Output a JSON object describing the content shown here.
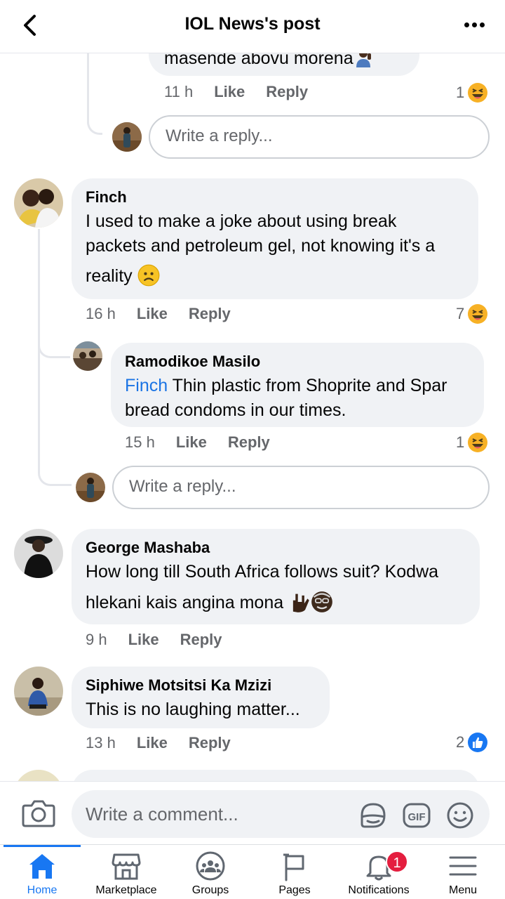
{
  "header": {
    "title": "IOL News's post"
  },
  "comments": {
    "prev_reply": {
      "text_tail": "masende abovu morena",
      "time": "11 h",
      "like": "Like",
      "reply": "Reply",
      "reaction_count": "1",
      "reaction_icon": "haha-icon"
    },
    "reply_box_1": {
      "placeholder": "Write a reply..."
    },
    "finch": {
      "author": "Finch",
      "text_1": "I used to make a joke about using break",
      "text_2": "packets and petroleum gel, not knowing it's a",
      "text_3": "reality",
      "time": "16 h",
      "like": "Like",
      "reply": "Reply",
      "reaction_count": "7",
      "reaction_icon": "haha-icon"
    },
    "ramodikoe": {
      "author": "Ramodikoe Masilo",
      "mention": "Finch",
      "text_1": " Thin plastic from Shoprite and Spar",
      "text_2": "bread condoms in our times.",
      "time": "15 h",
      "like": "Like",
      "reply": "Reply",
      "reaction_count": "1",
      "reaction_icon": "haha-icon"
    },
    "reply_box_2": {
      "placeholder": "Write a reply..."
    },
    "george": {
      "author": "George Mashaba",
      "text_1": "How long till South Africa follows suit? Kodwa",
      "text_2": "hlekani kais angina mona",
      "time": "9 h",
      "like": "Like",
      "reply": "Reply"
    },
    "siphiwe": {
      "author": "Siphiwe Motsitsi Ka Mzizi",
      "text_1": "This is no laughing matter...",
      "time": "13 h",
      "like": "Like",
      "reply": "Reply",
      "reaction_count": "2",
      "reaction_icon": "like-icon"
    }
  },
  "composer": {
    "placeholder": "Write a comment..."
  },
  "tabs": [
    {
      "label": "Home",
      "icon": "home-icon",
      "active": true
    },
    {
      "label": "Marketplace",
      "icon": "marketplace-icon"
    },
    {
      "label": "Groups",
      "icon": "groups-icon"
    },
    {
      "label": "Pages",
      "icon": "pages-icon"
    },
    {
      "label": "Notifications",
      "icon": "bell-icon",
      "badge": "1"
    },
    {
      "label": "Menu",
      "icon": "menu-icon"
    }
  ],
  "colors": {
    "accent": "#1877f2",
    "bubble": "#f0f2f5",
    "meta": "#65676b",
    "badge": "#e41e3f"
  }
}
